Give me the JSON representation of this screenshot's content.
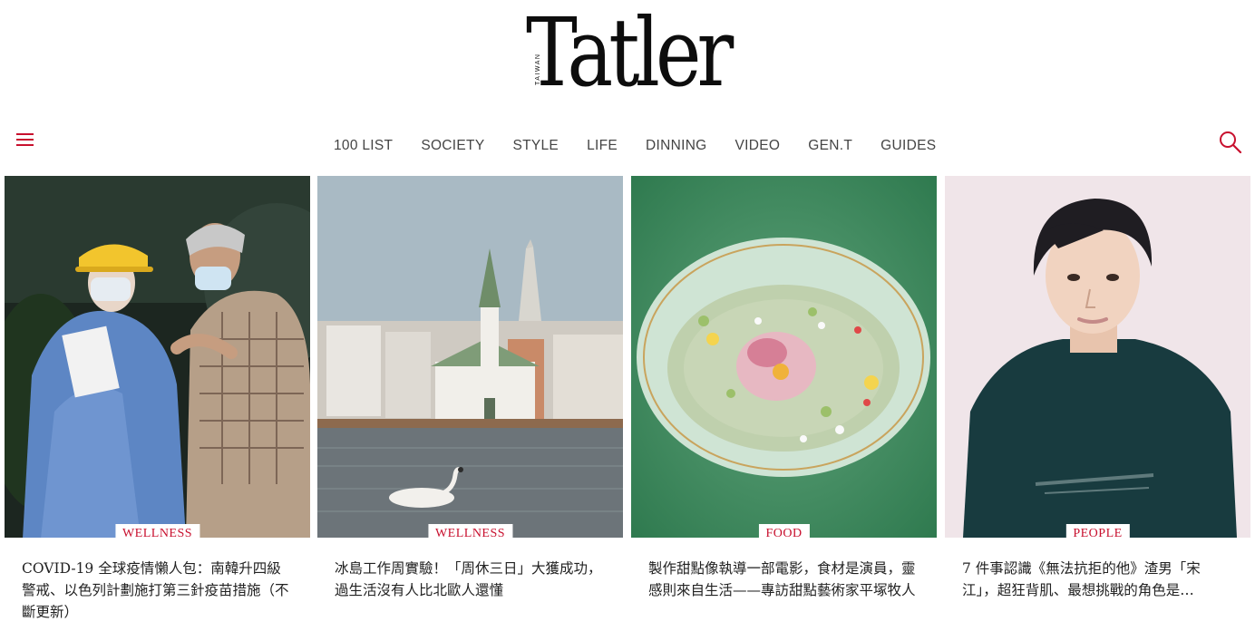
{
  "brand": {
    "region": "TAIWAN",
    "name": "Tatler"
  },
  "nav": {
    "items": [
      "100 LIST",
      "SOCIETY",
      "STYLE",
      "LIFE",
      "DINNING",
      "VIDEO",
      "GEN.T",
      "GUIDES"
    ]
  },
  "icons": {
    "menu": "hamburger-menu-icon",
    "search": "search-icon"
  },
  "colors": {
    "accent": "#c8102e",
    "text": "#222222",
    "nav_text": "#444444"
  },
  "articles": [
    {
      "category": "WELLNESS",
      "title": "COVID-19 全球疫情懶人包：南韓升四級警戒、以色列計劃施打第三針疫苗措施（不斷更新）"
    },
    {
      "category": "WELLNESS",
      "title": "冰島工作周實驗！「周休三日」大獲成功，過生活沒有人比北歐人還懂"
    },
    {
      "category": "FOOD",
      "title": "製作甜點像執導一部電影，食材是演員，靈感則來自生活——專訪甜點藝術家平塚牧人"
    },
    {
      "category": "PEOPLE",
      "title": "7 件事認識《無法抗拒的他》渣男「宋江」，超狂背肌、最想挑戰的角色是…"
    }
  ]
}
